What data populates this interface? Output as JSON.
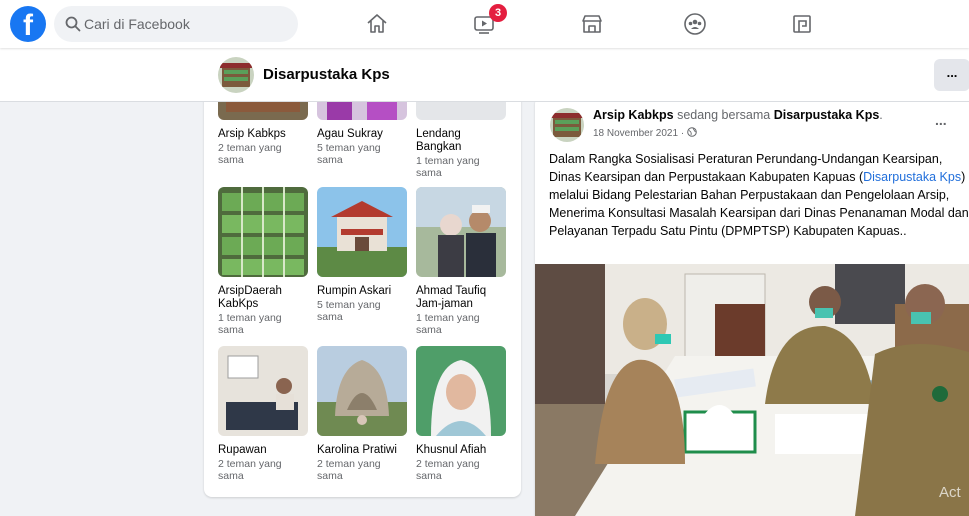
{
  "topbar": {
    "search_placeholder": "Cari di Facebook",
    "video_badge": "3",
    "accent_color": "#1877f2",
    "icons": [
      "home-icon",
      "watch-icon",
      "marketplace-icon",
      "groups-icon",
      "gaming-icon"
    ]
  },
  "page": {
    "name": "Disarpustaka Kps",
    "more_label": "..."
  },
  "friends": [
    {
      "name": "Arsip Kabkps",
      "mutual": "2 teman yang sama"
    },
    {
      "name": "Agau Sukray",
      "mutual": "5 teman yang sama"
    },
    {
      "name": "Lendang Bangkan",
      "mutual": "1 teman yang sama"
    },
    {
      "name": "ArsipDaerah KabKps",
      "mutual": "1 teman yang sama"
    },
    {
      "name": "Rumpin Askari",
      "mutual": "5 teman yang sama"
    },
    {
      "name": "Ahmad Taufiq Jam-jaman",
      "mutual": "1 teman yang sama"
    },
    {
      "name": "Rupawan",
      "mutual": "2 teman yang sama"
    },
    {
      "name": "Karolina Pratiwi",
      "mutual": "2 teman yang sama"
    },
    {
      "name": "Khusnul Afiah",
      "mutual": "2 teman yang sama"
    }
  ],
  "post": {
    "author": "Arsip Kabkps",
    "with_text": "sedang bersama",
    "tagged": "Disarpustaka Kps",
    "date": "18 November 2021",
    "dots": "...",
    "text_before": "Dalam Rangka Sosialisasi Peraturan Perundang-Undangan Kearsipan, Dinas Kearsipan dan Perpustakaan Kabupaten Kapuas (",
    "text_link": "Disarpustaka Kps",
    "text_after": ") melalui Bidang Pelestarian Bahan Perpustakaan dan Pengelolaan Arsip, Menerima Konsultasi Masalah Kearsipan dari Dinas Penanaman Modal dan Pelayanan Terpadu Satu Pintu (DPMPTSP) Kabupaten Kapuas..",
    "watermark": "Act"
  }
}
